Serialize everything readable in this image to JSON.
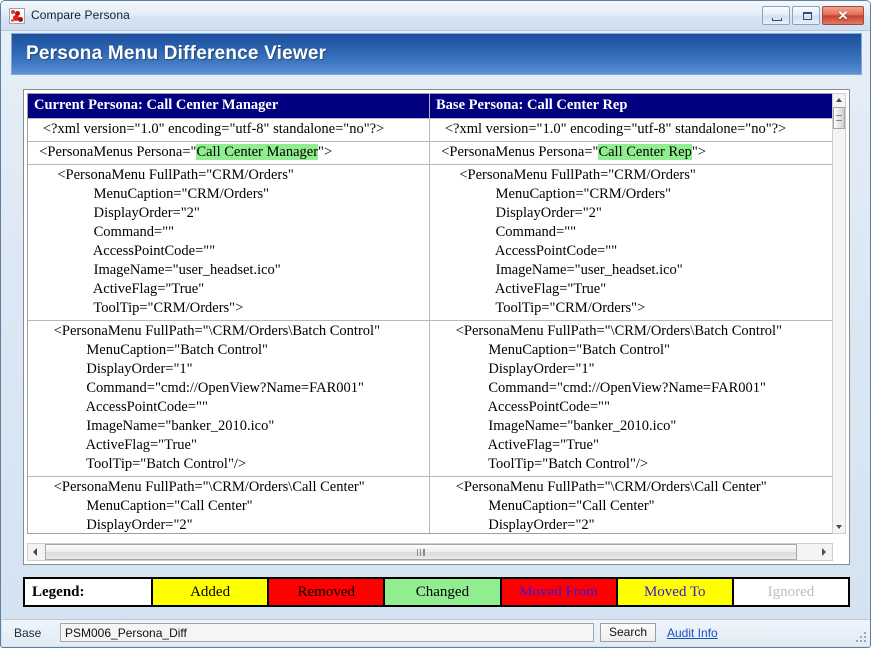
{
  "window": {
    "title": "Compare Persona",
    "icon": "app-dots-icon",
    "controls": {
      "minimize": "minimize-icon",
      "maximize": "maximize-icon",
      "close": "✕"
    }
  },
  "banner": {
    "title": "Persona Menu Difference Viewer"
  },
  "diff": {
    "left_header": "Current Persona: Call Center Manager",
    "right_header": "Base Persona: Call Center Rep",
    "rows": [
      {
        "left": "   <?xml version=\"1.0\" encoding=\"utf-8\" standalone=\"no\"?>",
        "right": "   <?xml version=\"1.0\" encoding=\"utf-8\" standalone=\"no\"?>"
      },
      {
        "left_pre": "  <PersonaMenus Persona=\"",
        "left_hl": "Call Center Manager",
        "left_post": "\">",
        "right_pre": "  <PersonaMenus Persona=\"",
        "right_hl": "Call Center Rep",
        "right_post": "\">"
      },
      {
        "left": "       <PersonaMenu FullPath=\"CRM/Orders\"\n                 MenuCaption=\"CRM/Orders\"\n                 DisplayOrder=\"2\"\n                 Command=\"\"\n                 AccessPointCode=\"\"\n                 ImageName=\"user_headset.ico\"\n                 ActiveFlag=\"True\"\n                 ToolTip=\"CRM/Orders\">",
        "right": "       <PersonaMenu FullPath=\"CRM/Orders\"\n                 MenuCaption=\"CRM/Orders\"\n                 DisplayOrder=\"2\"\n                 Command=\"\"\n                 AccessPointCode=\"\"\n                 ImageName=\"user_headset.ico\"\n                 ActiveFlag=\"True\"\n                 ToolTip=\"CRM/Orders\">"
      },
      {
        "left": "      <PersonaMenu FullPath=\"\\CRM/Orders\\Batch Control\"\n               MenuCaption=\"Batch Control\"\n               DisplayOrder=\"1\"\n               Command=\"cmd://OpenView?Name=FAR001\"\n               AccessPointCode=\"\"\n               ImageName=\"banker_2010.ico\"\n               ActiveFlag=\"True\"\n               ToolTip=\"Batch Control\"/>",
        "right": "      <PersonaMenu FullPath=\"\\CRM/Orders\\Batch Control\"\n               MenuCaption=\"Batch Control\"\n               DisplayOrder=\"1\"\n               Command=\"cmd://OpenView?Name=FAR001\"\n               AccessPointCode=\"\"\n               ImageName=\"banker_2010.ico\"\n               ActiveFlag=\"True\"\n               ToolTip=\"Batch Control\"/>"
      },
      {
        "left": "      <PersonaMenu FullPath=\"\\CRM/Orders\\Call Center\"\n               MenuCaption=\"Call Center\"\n               DisplayOrder=\"2\"",
        "right": "      <PersonaMenu FullPath=\"\\CRM/Orders\\Call Center\"\n               MenuCaption=\"Call Center\"\n               DisplayOrder=\"2\""
      }
    ]
  },
  "legend": {
    "label": "Legend:",
    "items": [
      {
        "text": "Added",
        "bg": "#ffff00",
        "fg": "#000000"
      },
      {
        "text": "Removed",
        "bg": "#ff0000",
        "fg": "#000000"
      },
      {
        "text": "Changed",
        "bg": "#90ee90",
        "fg": "#000000"
      },
      {
        "text": "Moved From",
        "bg": "#ff0000",
        "fg": "#3a17d8"
      },
      {
        "text": "Moved To",
        "bg": "#ffff00",
        "fg": "#3a17d8"
      },
      {
        "text": "Ignored",
        "bg": "#ffffff",
        "fg": "#bdbdbd"
      }
    ]
  },
  "statusbar": {
    "base_label": "Base",
    "base_value": "PSM006_Persona_Diff",
    "search_button": "Search",
    "audit_link": "Audit Info"
  }
}
